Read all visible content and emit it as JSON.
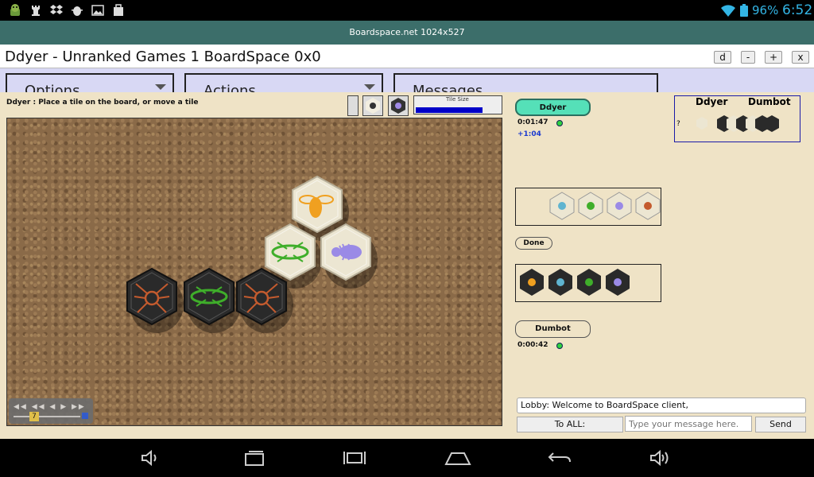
{
  "status_bar": {
    "battery_pct": "96%",
    "clock": "6:52",
    "icons": [
      "android-icon",
      "chess-rook-icon",
      "dropbox-icon",
      "android-bug-icon",
      "image-icon",
      "bag-icon",
      "wifi-icon",
      "battery-icon"
    ]
  },
  "app_title": "Boardspace.net 1024x527",
  "window": {
    "title": "Ddyer - Unranked Games 1 BoardSpace 0x0",
    "buttons": [
      "d",
      "-",
      "+",
      "x"
    ]
  },
  "menus": [
    "Options",
    "Actions",
    "Messages"
  ],
  "game": {
    "prompt": "Ddyer : Place a tile on the board, or move a tile",
    "tile_size_label": "Tile Size",
    "tile_size_fraction": 0.78,
    "replay_move": "7"
  },
  "players": {
    "p1": {
      "name": "Ddyer",
      "time": "0:01:47",
      "extra": "+1:04",
      "color": "#55e0b8"
    },
    "p2": {
      "name": "Dumbot",
      "time": "0:00:42",
      "color": "#efe3c6"
    },
    "done_label": "Done"
  },
  "scoreboard": {
    "p1": "Ddyer",
    "p2": "Dumbot",
    "marker": "?"
  },
  "chat": {
    "log": "Lobby: Welcome to BoardSpace client,",
    "to_all": "To ALL:",
    "placeholder": "Type your message here.",
    "send": "Send"
  },
  "colors": {
    "white_tile": "#ece6d2",
    "black_tile": "#2a2a2a",
    "spider": "#c45b2e",
    "grasshopper": "#3fae2a",
    "ant": "#9a8ae6",
    "bee": "#f0a020"
  }
}
